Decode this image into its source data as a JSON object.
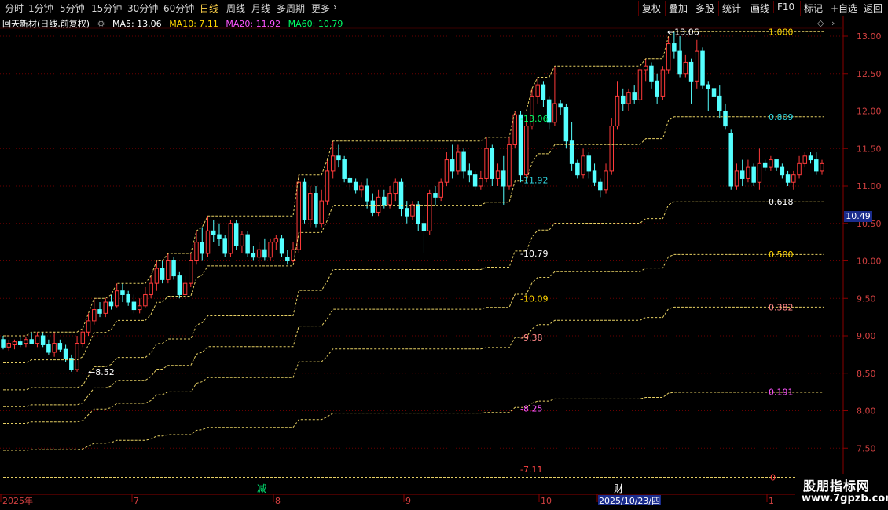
{
  "toolbar": {
    "periods": [
      "分时",
      "1分钟",
      "5分钟",
      "15分钟",
      "30分钟",
      "60分钟",
      "日线",
      "周线",
      "月线",
      "多周期",
      "更多"
    ],
    "active_period": "日线",
    "more_icon": "chevron-right-icon",
    "actions": [
      "复权",
      "叠加",
      "多股",
      "统计",
      "画线",
      "F10",
      "+自选",
      "返回"
    ],
    "extra": "标记"
  },
  "chart_header": {
    "stock": "回天新材(日线,前复权)",
    "ma5": "MA5: 13.06",
    "ma10": "MA10: 7.11",
    "ma20": "MA20: 11.92",
    "ma60": "MA60: 10.79",
    "colors": {
      "ma5": "#ffffff",
      "ma10": "#ffd700",
      "ma20": "#ff55ff",
      "ma60": "#00ff66"
    }
  },
  "current_price": "10.49",
  "watermark": {
    "title": "股朋指标网",
    "url": "www.7gpzb.com"
  },
  "chart_data": {
    "type": "candlestick",
    "ylim": [
      7.0,
      13.2
    ],
    "y_ticks": [
      "13.00",
      "12.50",
      "12.00",
      "11.50",
      "11.00",
      "10.50",
      "10.00",
      "9.50",
      "9.00",
      "8.50",
      "8.00",
      "7.50"
    ],
    "x_labels": [
      "2025年",
      "7",
      "8",
      "9",
      "10",
      "2025/10/23/四",
      "1"
    ],
    "events": [
      "减",
      "财"
    ],
    "annotations": [
      {
        "text": "13.06",
        "value": 13.06,
        "color": "#ffffff"
      },
      {
        "text": "8.52",
        "value": 8.52,
        "color": "#ffffff"
      },
      {
        "text": "13.06",
        "value": 11.9,
        "color": "#00ff66"
      },
      {
        "text": "11.92",
        "value": 11.08,
        "color": "#2fd6e0"
      },
      {
        "text": "10.79",
        "value": 10.1,
        "color": "#ffffff"
      },
      {
        "text": "10.09",
        "value": 9.5,
        "color": "#ffd700"
      },
      {
        "text": "9.38",
        "value": 8.98,
        "color": "#ff8888"
      },
      {
        "text": "8.25",
        "value": 8.03,
        "color": "#ff55ff"
      },
      {
        "text": "7.11",
        "value": 7.22,
        "color": "#ff4444"
      }
    ],
    "fib_labels": [
      {
        "text": "0.809",
        "value": 11.92,
        "color": "#2fd6e0"
      },
      {
        "text": "0.618",
        "value": 10.79,
        "color": "#ffffff"
      },
      {
        "text": "0.500",
        "value": 10.09,
        "color": "#ffd700"
      },
      {
        "text": "0.382",
        "value": 9.38,
        "color": "#ff8888"
      },
      {
        "text": "0.191",
        "value": 8.25,
        "color": "#ff55ff"
      },
      {
        "text": "0",
        "value": 7.11,
        "color": "#ff4444"
      },
      {
        "text": "1.000",
        "value": 13.06,
        "color": "#ffd700"
      }
    ],
    "candles": [
      {
        "o": 8.95,
        "h": 9.0,
        "l": 8.82,
        "c": 8.85
      },
      {
        "o": 8.85,
        "h": 8.95,
        "l": 8.8,
        "c": 8.9
      },
      {
        "o": 8.88,
        "h": 8.95,
        "l": 8.82,
        "c": 8.92
      },
      {
        "o": 8.92,
        "h": 9.0,
        "l": 8.85,
        "c": 8.88
      },
      {
        "o": 8.9,
        "h": 8.98,
        "l": 8.85,
        "c": 8.95
      },
      {
        "o": 8.95,
        "h": 9.05,
        "l": 8.9,
        "c": 8.9
      },
      {
        "o": 8.9,
        "h": 9.05,
        "l": 8.85,
        "c": 9.0
      },
      {
        "o": 9.0,
        "h": 9.05,
        "l": 8.85,
        "c": 8.88
      },
      {
        "o": 8.88,
        "h": 8.95,
        "l": 8.75,
        "c": 8.78
      },
      {
        "o": 8.78,
        "h": 9.05,
        "l": 8.72,
        "c": 8.9
      },
      {
        "o": 8.9,
        "h": 8.95,
        "l": 8.78,
        "c": 8.82
      },
      {
        "o": 8.82,
        "h": 8.88,
        "l": 8.65,
        "c": 8.7
      },
      {
        "o": 8.7,
        "h": 8.75,
        "l": 8.52,
        "c": 8.55
      },
      {
        "o": 8.55,
        "h": 9.0,
        "l": 8.52,
        "c": 8.9
      },
      {
        "o": 8.9,
        "h": 9.1,
        "l": 8.85,
        "c": 9.05
      },
      {
        "o": 9.05,
        "h": 9.3,
        "l": 9.0,
        "c": 9.2
      },
      {
        "o": 9.2,
        "h": 9.5,
        "l": 9.15,
        "c": 9.35
      },
      {
        "o": 9.35,
        "h": 9.45,
        "l": 9.25,
        "c": 9.3
      },
      {
        "o": 9.3,
        "h": 9.5,
        "l": 9.25,
        "c": 9.45
      },
      {
        "o": 9.45,
        "h": 9.55,
        "l": 9.35,
        "c": 9.4
      },
      {
        "o": 9.4,
        "h": 9.7,
        "l": 9.38,
        "c": 9.6
      },
      {
        "o": 9.6,
        "h": 9.7,
        "l": 9.45,
        "c": 9.55
      },
      {
        "o": 9.55,
        "h": 9.6,
        "l": 9.4,
        "c": 9.45
      },
      {
        "o": 9.45,
        "h": 9.55,
        "l": 9.3,
        "c": 9.35
      },
      {
        "o": 9.35,
        "h": 9.5,
        "l": 9.3,
        "c": 9.4
      },
      {
        "o": 9.4,
        "h": 9.65,
        "l": 9.38,
        "c": 9.55
      },
      {
        "o": 9.55,
        "h": 9.8,
        "l": 9.5,
        "c": 9.7
      },
      {
        "o": 9.7,
        "h": 10.0,
        "l": 9.6,
        "c": 9.9
      },
      {
        "o": 9.9,
        "h": 10.0,
        "l": 9.7,
        "c": 9.75
      },
      {
        "o": 9.75,
        "h": 10.1,
        "l": 9.7,
        "c": 10.0
      },
      {
        "o": 10.0,
        "h": 10.05,
        "l": 9.75,
        "c": 9.8
      },
      {
        "o": 9.8,
        "h": 9.85,
        "l": 9.5,
        "c": 9.55
      },
      {
        "o": 9.55,
        "h": 9.8,
        "l": 9.5,
        "c": 9.7
      },
      {
        "o": 9.7,
        "h": 10.1,
        "l": 9.65,
        "c": 10.0
      },
      {
        "o": 10.0,
        "h": 10.4,
        "l": 9.95,
        "c": 10.25
      },
      {
        "o": 10.25,
        "h": 10.45,
        "l": 10.0,
        "c": 10.1
      },
      {
        "o": 10.1,
        "h": 10.6,
        "l": 10.05,
        "c": 10.4
      },
      {
        "o": 10.4,
        "h": 10.55,
        "l": 10.25,
        "c": 10.35
      },
      {
        "o": 10.35,
        "h": 10.5,
        "l": 10.2,
        "c": 10.3
      },
      {
        "o": 10.3,
        "h": 10.35,
        "l": 10.05,
        "c": 10.1
      },
      {
        "o": 10.1,
        "h": 10.55,
        "l": 10.05,
        "c": 10.5
      },
      {
        "o": 10.5,
        "h": 10.55,
        "l": 10.15,
        "c": 10.2
      },
      {
        "o": 10.2,
        "h": 10.4,
        "l": 10.1,
        "c": 10.35
      },
      {
        "o": 10.35,
        "h": 10.4,
        "l": 10.05,
        "c": 10.1
      },
      {
        "o": 10.1,
        "h": 10.2,
        "l": 10.0,
        "c": 10.05
      },
      {
        "o": 10.05,
        "h": 10.25,
        "l": 9.95,
        "c": 10.15
      },
      {
        "o": 10.15,
        "h": 10.3,
        "l": 10.0,
        "c": 10.05
      },
      {
        "o": 10.05,
        "h": 10.3,
        "l": 10.0,
        "c": 10.25
      },
      {
        "o": 10.25,
        "h": 10.35,
        "l": 10.15,
        "c": 10.3
      },
      {
        "o": 10.3,
        "h": 10.35,
        "l": 10.05,
        "c": 10.1
      },
      {
        "o": 10.05,
        "h": 10.15,
        "l": 9.95,
        "c": 10.0
      },
      {
        "o": 10.0,
        "h": 10.25,
        "l": 9.98,
        "c": 10.15
      },
      {
        "o": 10.15,
        "h": 11.15,
        "l": 10.1,
        "c": 11.05
      },
      {
        "o": 11.05,
        "h": 11.1,
        "l": 10.5,
        "c": 10.55
      },
      {
        "o": 10.55,
        "h": 11.0,
        "l": 10.45,
        "c": 10.9
      },
      {
        "o": 10.9,
        "h": 11.0,
        "l": 10.45,
        "c": 10.5
      },
      {
        "o": 10.5,
        "h": 10.95,
        "l": 10.45,
        "c": 10.8
      },
      {
        "o": 10.8,
        "h": 11.35,
        "l": 10.75,
        "c": 11.2
      },
      {
        "o": 11.2,
        "h": 11.6,
        "l": 11.1,
        "c": 11.4
      },
      {
        "o": 11.4,
        "h": 11.55,
        "l": 11.25,
        "c": 11.35
      },
      {
        "o": 11.35,
        "h": 11.4,
        "l": 11.05,
        "c": 11.1
      },
      {
        "o": 11.1,
        "h": 11.15,
        "l": 10.95,
        "c": 11.05
      },
      {
        "o": 11.05,
        "h": 11.1,
        "l": 10.9,
        "c": 10.95
      },
      {
        "o": 10.95,
        "h": 11.05,
        "l": 10.85,
        "c": 11.0
      },
      {
        "o": 11.0,
        "h": 11.1,
        "l": 10.7,
        "c": 10.8
      },
      {
        "o": 10.8,
        "h": 10.9,
        "l": 10.6,
        "c": 10.65
      },
      {
        "o": 10.65,
        "h": 10.95,
        "l": 10.6,
        "c": 10.85
      },
      {
        "o": 10.85,
        "h": 10.95,
        "l": 10.7,
        "c": 10.75
      },
      {
        "o": 10.75,
        "h": 11.0,
        "l": 10.7,
        "c": 10.9
      },
      {
        "o": 10.9,
        "h": 11.1,
        "l": 10.8,
        "c": 11.05
      },
      {
        "o": 11.05,
        "h": 11.1,
        "l": 10.6,
        "c": 10.7
      },
      {
        "o": 10.7,
        "h": 10.8,
        "l": 10.5,
        "c": 10.6
      },
      {
        "o": 10.6,
        "h": 10.8,
        "l": 10.55,
        "c": 10.75
      },
      {
        "o": 10.75,
        "h": 10.8,
        "l": 10.4,
        "c": 10.5
      },
      {
        "o": 10.5,
        "h": 10.6,
        "l": 10.1,
        "c": 10.4
      },
      {
        "o": 10.4,
        "h": 10.95,
        "l": 10.35,
        "c": 10.9
      },
      {
        "o": 10.9,
        "h": 11.0,
        "l": 10.75,
        "c": 10.85
      },
      {
        "o": 10.85,
        "h": 11.1,
        "l": 10.8,
        "c": 11.05
      },
      {
        "o": 11.05,
        "h": 11.45,
        "l": 11.0,
        "c": 11.35
      },
      {
        "o": 11.35,
        "h": 11.55,
        "l": 11.1,
        "c": 11.2
      },
      {
        "o": 11.2,
        "h": 11.55,
        "l": 11.15,
        "c": 11.45
      },
      {
        "o": 11.45,
        "h": 11.5,
        "l": 11.1,
        "c": 11.2
      },
      {
        "o": 11.2,
        "h": 11.3,
        "l": 11.05,
        "c": 11.15
      },
      {
        "o": 11.15,
        "h": 11.2,
        "l": 10.95,
        "c": 11.0
      },
      {
        "o": 11.0,
        "h": 11.2,
        "l": 10.95,
        "c": 11.1
      },
      {
        "o": 11.1,
        "h": 11.65,
        "l": 11.05,
        "c": 11.5
      },
      {
        "o": 11.5,
        "h": 11.55,
        "l": 11.0,
        "c": 11.1
      },
      {
        "o": 11.1,
        "h": 11.3,
        "l": 11.0,
        "c": 11.2
      },
      {
        "o": 11.2,
        "h": 11.4,
        "l": 10.75,
        "c": 11.0
      },
      {
        "o": 11.0,
        "h": 11.65,
        "l": 10.95,
        "c": 11.55
      },
      {
        "o": 11.55,
        "h": 12.0,
        "l": 11.5,
        "c": 11.95
      },
      {
        "o": 11.95,
        "h": 12.0,
        "l": 11.05,
        "c": 11.15
      },
      {
        "o": 11.15,
        "h": 11.9,
        "l": 11.1,
        "c": 11.8
      },
      {
        "o": 11.8,
        "h": 12.3,
        "l": 11.75,
        "c": 12.2
      },
      {
        "o": 12.2,
        "h": 12.45,
        "l": 12.1,
        "c": 12.35
      },
      {
        "o": 12.35,
        "h": 12.4,
        "l": 12.05,
        "c": 12.15
      },
      {
        "o": 12.15,
        "h": 12.2,
        "l": 11.75,
        "c": 11.85
      },
      {
        "o": 11.85,
        "h": 12.6,
        "l": 11.8,
        "c": 12.1
      },
      {
        "o": 12.1,
        "h": 12.15,
        "l": 11.95,
        "c": 12.05
      },
      {
        "o": 12.05,
        "h": 12.1,
        "l": 11.5,
        "c": 11.6
      },
      {
        "o": 11.6,
        "h": 11.85,
        "l": 11.2,
        "c": 11.3
      },
      {
        "o": 11.3,
        "h": 11.35,
        "l": 11.1,
        "c": 11.15
      },
      {
        "o": 11.15,
        "h": 11.5,
        "l": 11.1,
        "c": 11.4
      },
      {
        "o": 11.4,
        "h": 11.45,
        "l": 11.1,
        "c": 11.2
      },
      {
        "o": 11.2,
        "h": 11.3,
        "l": 11.0,
        "c": 11.05
      },
      {
        "o": 11.05,
        "h": 11.1,
        "l": 10.85,
        "c": 10.95
      },
      {
        "o": 10.95,
        "h": 11.3,
        "l": 10.9,
        "c": 11.2
      },
      {
        "o": 11.2,
        "h": 11.9,
        "l": 11.15,
        "c": 11.8
      },
      {
        "o": 11.8,
        "h": 12.4,
        "l": 11.75,
        "c": 12.2
      },
      {
        "o": 12.2,
        "h": 12.3,
        "l": 12.0,
        "c": 12.1
      },
      {
        "o": 12.1,
        "h": 12.3,
        "l": 12.0,
        "c": 12.25
      },
      {
        "o": 12.25,
        "h": 12.35,
        "l": 12.1,
        "c": 12.15
      },
      {
        "o": 12.15,
        "h": 12.6,
        "l": 12.1,
        "c": 12.55
      },
      {
        "o": 12.55,
        "h": 12.7,
        "l": 12.4,
        "c": 12.6
      },
      {
        "o": 12.6,
        "h": 12.65,
        "l": 12.3,
        "c": 12.4
      },
      {
        "o": 12.4,
        "h": 12.5,
        "l": 12.1,
        "c": 12.2
      },
      {
        "o": 12.2,
        "h": 12.6,
        "l": 12.15,
        "c": 12.55
      },
      {
        "o": 12.55,
        "h": 13.0,
        "l": 12.5,
        "c": 12.9
      },
      {
        "o": 12.9,
        "h": 13.06,
        "l": 12.7,
        "c": 12.8
      },
      {
        "o": 12.8,
        "h": 13.0,
        "l": 12.45,
        "c": 12.5
      },
      {
        "o": 12.5,
        "h": 12.75,
        "l": 12.45,
        "c": 12.65
      },
      {
        "o": 12.65,
        "h": 12.7,
        "l": 12.1,
        "c": 12.4
      },
      {
        "o": 12.4,
        "h": 12.95,
        "l": 12.3,
        "c": 12.8
      },
      {
        "o": 12.8,
        "h": 12.85,
        "l": 12.3,
        "c": 12.35
      },
      {
        "o": 12.35,
        "h": 12.4,
        "l": 12.0,
        "c": 12.3
      },
      {
        "o": 12.3,
        "h": 12.5,
        "l": 12.15,
        "c": 12.2
      },
      {
        "o": 12.2,
        "h": 12.35,
        "l": 11.9,
        "c": 12.0
      },
      {
        "o": 12.0,
        "h": 12.1,
        "l": 11.75,
        "c": 11.8
      },
      {
        "o": 11.7,
        "h": 11.75,
        "l": 10.95,
        "c": 11.0
      },
      {
        "o": 11.0,
        "h": 11.3,
        "l": 10.95,
        "c": 11.2
      },
      {
        "o": 11.2,
        "h": 11.35,
        "l": 11.0,
        "c": 11.1
      },
      {
        "o": 11.1,
        "h": 11.35,
        "l": 11.05,
        "c": 11.25
      },
      {
        "o": 11.25,
        "h": 11.3,
        "l": 11.0,
        "c": 11.05
      },
      {
        "o": 11.05,
        "h": 11.5,
        "l": 10.95,
        "c": 11.3
      },
      {
        "o": 11.3,
        "h": 11.35,
        "l": 11.2,
        "c": 11.25
      },
      {
        "o": 11.25,
        "h": 11.4,
        "l": 11.2,
        "c": 11.35
      },
      {
        "o": 11.35,
        "h": 11.35,
        "l": 11.2,
        "c": 11.25
      },
      {
        "o": 11.25,
        "h": 11.3,
        "l": 11.1,
        "c": 11.15
      },
      {
        "o": 11.15,
        "h": 11.2,
        "l": 11.0,
        "c": 11.05
      },
      {
        "o": 11.05,
        "h": 11.2,
        "l": 10.95,
        "c": 11.15
      },
      {
        "o": 11.15,
        "h": 11.4,
        "l": 11.1,
        "c": 11.3
      },
      {
        "o": 11.3,
        "h": 11.45,
        "l": 11.25,
        "c": 11.4
      },
      {
        "o": 11.4,
        "h": 11.45,
        "l": 11.3,
        "c": 11.35
      },
      {
        "o": 11.35,
        "h": 11.45,
        "l": 11.15,
        "c": 11.2
      },
      {
        "o": 11.2,
        "h": 11.35,
        "l": 11.15,
        "c": 11.3
      }
    ]
  }
}
